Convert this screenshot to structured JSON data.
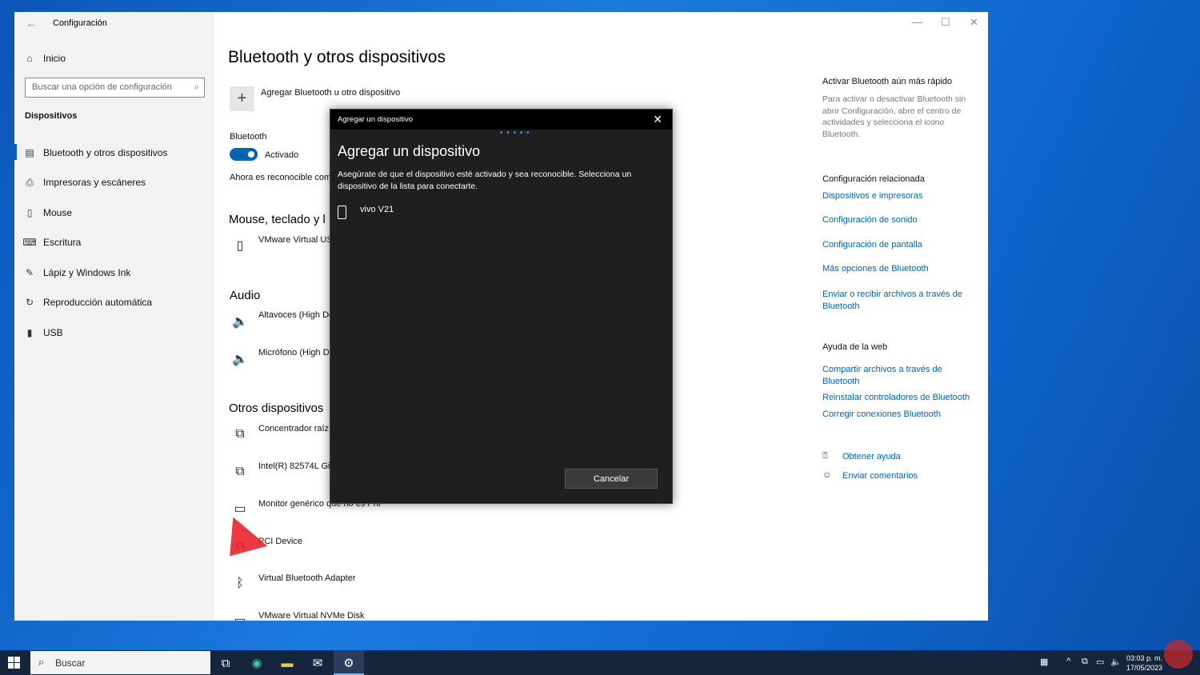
{
  "window": {
    "title": "Configuración",
    "controls": {
      "minimize": "—",
      "maximize": "☐",
      "close": "✕"
    }
  },
  "sidebar": {
    "home": "Inicio",
    "search_placeholder": "Buscar una opción de configuración",
    "section": "Dispositivos",
    "items": [
      {
        "label": "Bluetooth y otros dispositivos",
        "icon": "bluetooth-devices-icon"
      },
      {
        "label": "Impresoras y escáneres",
        "icon": "printer-icon"
      },
      {
        "label": "Mouse",
        "icon": "mouse-icon"
      },
      {
        "label": "Escritura",
        "icon": "keyboard-icon"
      },
      {
        "label": "Lápiz y Windows Ink",
        "icon": "pen-icon"
      },
      {
        "label": "Reproducción automática",
        "icon": "autoplay-icon"
      },
      {
        "label": "USB",
        "icon": "usb-icon"
      }
    ]
  },
  "main": {
    "title": "Bluetooth y otros dispositivos",
    "add_device": "Agregar Bluetooth u otro dispositivo",
    "bluetooth_label": "Bluetooth",
    "bluetooth_state": "Activado",
    "discoverable": "Ahora es reconocible com",
    "mouse_section": "Mouse, teclado y l",
    "mouse_device": "VMware Virtual US",
    "audio_section": "Audio",
    "audio_devices": [
      "Altavoces (High De",
      "Micrófono (High D"
    ],
    "other_section": "Otros dispositivos",
    "other_devices": [
      "Concentrador raíz",
      "Intel(R) 82574L Gig",
      "Monitor genérico que no es PnP",
      "PCI Device",
      "Virtual Bluetooth Adapter",
      "VMware Virtual NVMe Disk"
    ]
  },
  "right": {
    "quick_title": "Activar Bluetooth aún más rápido",
    "quick_desc": "Para activar o desactivar Bluetooth sin abrir Configuración, abre el centro de actividades y selecciona el icono Bluetooth.",
    "related_title": "Configuración relacionada",
    "related_links": [
      "Dispositivos e impresoras",
      "Configuración de sonido",
      "Configuración de pantalla",
      "Más opciones de Bluetooth",
      "Enviar o recibir archivos a través de Bluetooth"
    ],
    "web_title": "Ayuda de la web",
    "web_links": [
      "Compartir archivos a través de Bluetooth",
      "Reinstalar controladores de Bluetooth",
      "Corregir conexiones Bluetooth"
    ],
    "help": "Obtener ayuda",
    "feedback": "Enviar comentarios"
  },
  "dialog": {
    "titlebar": "Agregar un dispositivo",
    "heading": "Agregar un dispositivo",
    "description": "Asegúrate de que el dispositivo esté activado y sea reconocible. Selecciona un dispositivo de la lista para conectarte.",
    "device": "vivo V21",
    "cancel": "Cancelar",
    "progress_dots": "• • • •   •"
  },
  "taskbar": {
    "search": "Buscar",
    "time": "03:03 p. m.",
    "date": "17/05/2023"
  },
  "colors": {
    "accent": "#0063b1",
    "dialog_bg": "#1f1f1f",
    "taskbar": "#16253e"
  }
}
